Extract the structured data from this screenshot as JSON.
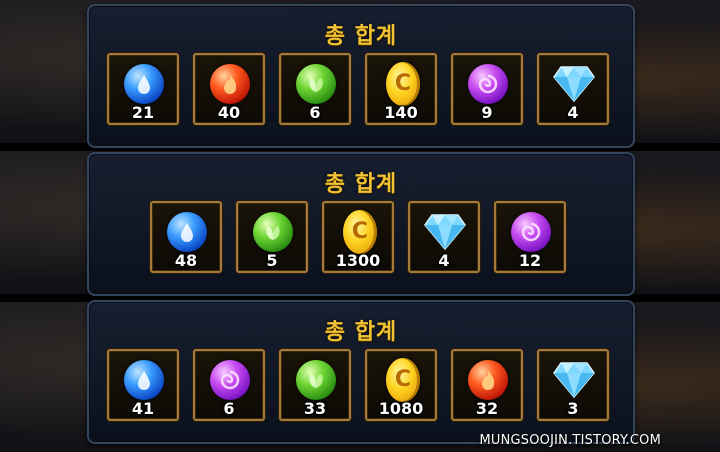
{
  "panels": [
    {
      "title": "총 합계",
      "items": [
        {
          "icon": "water-orb-icon",
          "count": "21"
        },
        {
          "icon": "fire-orb-icon",
          "count": "40"
        },
        {
          "icon": "leaf-orb-icon",
          "count": "6"
        },
        {
          "icon": "gold-coin-icon",
          "count": "140"
        },
        {
          "icon": "purple-orb-icon",
          "count": "9"
        },
        {
          "icon": "diamond-icon",
          "count": "4"
        }
      ]
    },
    {
      "title": "총 합계",
      "items": [
        {
          "icon": "water-orb-icon",
          "count": "48"
        },
        {
          "icon": "leaf-orb-icon",
          "count": "5"
        },
        {
          "icon": "gold-coin-icon",
          "count": "1300"
        },
        {
          "icon": "diamond-icon",
          "count": "4"
        },
        {
          "icon": "purple-orb-icon",
          "count": "12"
        }
      ]
    },
    {
      "title": "총 합계",
      "items": [
        {
          "icon": "water-orb-icon",
          "count": "41"
        },
        {
          "icon": "purple-orb-icon",
          "count": "6"
        },
        {
          "icon": "leaf-orb-icon",
          "count": "33"
        },
        {
          "icon": "gold-coin-icon",
          "count": "1080"
        },
        {
          "icon": "fire-orb-icon",
          "count": "32"
        },
        {
          "icon": "diamond-icon",
          "count": "3"
        }
      ]
    }
  ],
  "coin_glyph": "C",
  "watermark": "MUNGSOOJIN.TISTORY.COM",
  "colors": {
    "title": "#f2c232",
    "slot_border": "#a47a3a",
    "panel_border": "#32465f"
  }
}
